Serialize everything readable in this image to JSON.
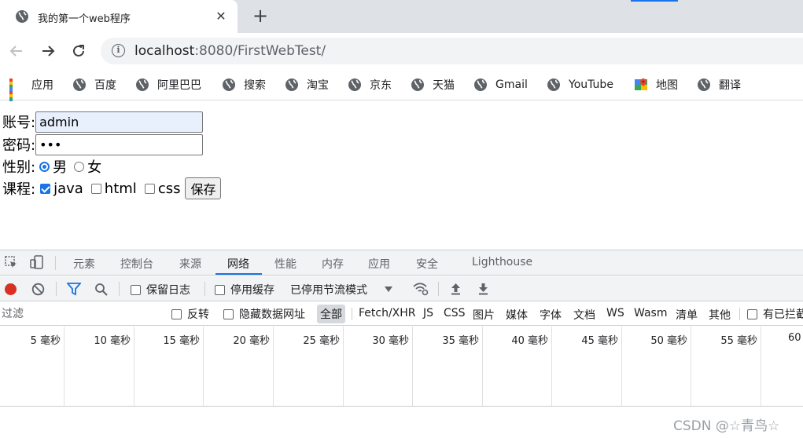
{
  "browser": {
    "tab_title": "我的第一个web程序",
    "tab_close": "✕",
    "new_tab": "+",
    "url_host": "localhost",
    "url_rest": ":8080/FirstWebTest/"
  },
  "bookmarks": [
    {
      "label": "应用",
      "icon": "apps-grid-icon"
    },
    {
      "label": "百度",
      "icon": "globe-icon"
    },
    {
      "label": "阿里巴巴",
      "icon": "globe-icon"
    },
    {
      "label": "搜索",
      "icon": "globe-icon"
    },
    {
      "label": "淘宝",
      "icon": "globe-icon"
    },
    {
      "label": "京东",
      "icon": "globe-icon"
    },
    {
      "label": "天猫",
      "icon": "globe-icon"
    },
    {
      "label": "Gmail",
      "icon": "globe-icon"
    },
    {
      "label": "YouTube",
      "icon": "globe-icon"
    },
    {
      "label": "地图",
      "icon": "maps-icon"
    },
    {
      "label": "翻译",
      "icon": "globe-icon"
    }
  ],
  "form": {
    "account_label": "账号:",
    "account_value": "admin",
    "password_label": "密码:",
    "password_value": "•••",
    "gender_label": "性别:",
    "gender_options": [
      {
        "label": "男",
        "selected": true
      },
      {
        "label": "女",
        "selected": false
      }
    ],
    "course_label": "课程:",
    "course_options": [
      {
        "label": "java",
        "checked": true
      },
      {
        "label": "html",
        "checked": false
      },
      {
        "label": "css",
        "checked": false
      }
    ],
    "save_label": "保存"
  },
  "devtools": {
    "tabs": [
      "元素",
      "控制台",
      "来源",
      "网络",
      "性能",
      "内存",
      "应用",
      "安全",
      "Lighthouse"
    ],
    "active_tab": "网络",
    "toolbar": {
      "preserve_log": "保留日志",
      "disable_cache": "停用缓存",
      "throttling": "已停用节流模式"
    },
    "filter": {
      "placeholder": "过滤",
      "invert": "反转",
      "hide_data_urls": "隐藏数据网址",
      "types": [
        "全部",
        "Fetch/XHR",
        "JS",
        "CSS",
        "图片",
        "媒体",
        "字体",
        "文档",
        "WS",
        "Wasm",
        "清单",
        "其他"
      ],
      "active_type": "全部",
      "blocked_cookies": "有已拦截"
    },
    "timeline_ticks": [
      "5 毫秒",
      "10 毫秒",
      "15 毫秒",
      "20 毫秒",
      "25 毫秒",
      "30 毫秒",
      "35 毫秒",
      "40 毫秒",
      "45 毫秒",
      "50 毫秒",
      "55 毫秒",
      "60"
    ]
  },
  "watermark": "CSDN @☆青鸟☆",
  "colors": {
    "accent": "#1a73e8",
    "record": "#d93025"
  }
}
